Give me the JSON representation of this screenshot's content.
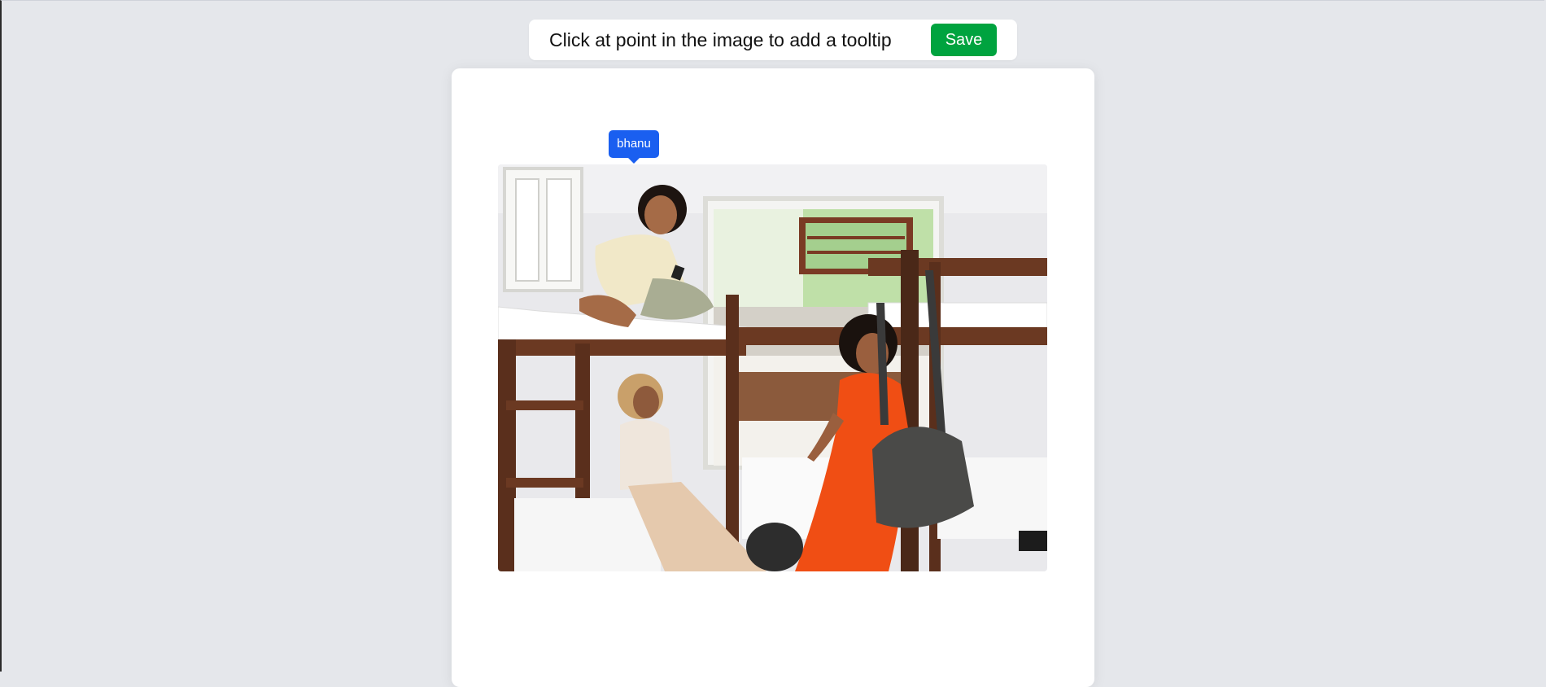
{
  "toolbar": {
    "instruction": "Click at point in the image to add a tooltip",
    "save_label": "Save",
    "save_color": "#00a33f"
  },
  "canvas": {
    "image_description_icon": "photo-icon",
    "tooltips": [
      {
        "label": "bhanu",
        "color": "#1a5ff0"
      }
    ]
  }
}
